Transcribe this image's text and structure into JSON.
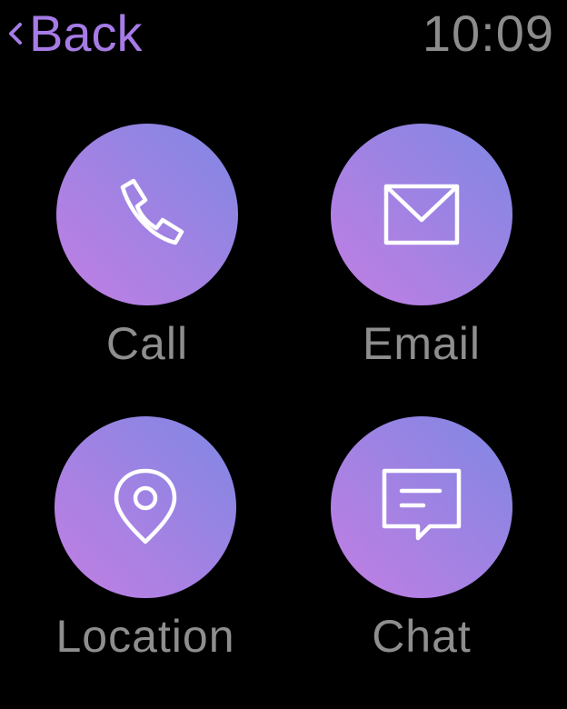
{
  "header": {
    "back_label": "Back",
    "time": "10:09"
  },
  "actions": [
    {
      "label": "Call",
      "icon": "phone-icon"
    },
    {
      "label": "Email",
      "icon": "envelope-icon"
    },
    {
      "label": "Location",
      "icon": "map-pin-icon"
    },
    {
      "label": "Chat",
      "icon": "chat-bubble-icon"
    }
  ],
  "colors": {
    "background": "#000000",
    "accent": "#a67be6",
    "clock": "#8c8c8c",
    "label": "#8e8e8e",
    "gradient_start": "#c27ee3",
    "gradient_end": "#7f87e3",
    "icon_stroke": "#ffffff"
  }
}
